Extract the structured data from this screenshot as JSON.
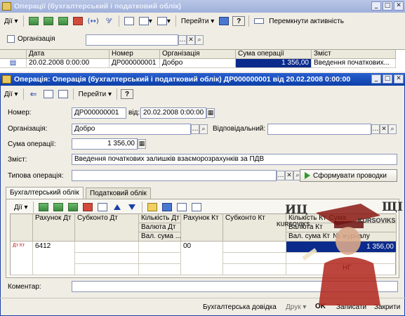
{
  "back_window": {
    "title": "Операції (бухгалтерський і податковий облік)",
    "toolbar": {
      "actions_label": "Дії",
      "goto_label": "Перейти",
      "toggle_activity_label": "Перемкнути активність"
    },
    "filter": {
      "org_label": "Організація",
      "org_value": ""
    },
    "columns": [
      "Дата",
      "Номер",
      "Організація",
      "Сума операції",
      "Зміст"
    ],
    "row": {
      "date": "20.02.2008 0:00:00",
      "number": "ДР000000001",
      "org": "Добро",
      "sum": "1 356,00",
      "content": "Введення початкових..."
    }
  },
  "form": {
    "title": "Операція: Операція (бухгалтерський і податковий облік) ДР000000001 від 20.02.2008 0:00:00",
    "toolbar": {
      "actions_label": "Дії",
      "goto_label": "Перейти"
    },
    "number_label": "Номер:",
    "number_value": "ДР000000001",
    "from_label": "від:",
    "date_value": "20.02.2008  0:00:00",
    "org_label": "Організація:",
    "org_value": "Добро",
    "responsible_label": "Відповідальний:",
    "responsible_value": "",
    "sum_label": "Сума операції:",
    "sum_value": "1 356,00",
    "content_label": "Зміст:",
    "content_value": "Введення початкових залишків взаєморозрахунків за ПДВ",
    "typical_label": "Типова операція:",
    "typical_value": "",
    "generate_label": "Сформувати проводки",
    "tabs": [
      "Бухгалтерський облік",
      "Податковий облік"
    ],
    "grid": {
      "actions_label": "Дії",
      "hdr_debit_account": "Рахунок Дт",
      "hdr_subconto_dt": "Субконто Дт",
      "hdr_qty_dt": "Кількість Дт",
      "hdr_currency_dt": "Валюта Дт",
      "hdr_cur_sum": "Вал. сума ...",
      "hdr_credit_account": "Рахунок Кт",
      "hdr_subconto_kt": "Субконто Кт",
      "hdr_qty_kt": "Кількість Кт",
      "hdr_sum": "Сума",
      "hdr_currency_kt": "Валюта Кт",
      "hdr_note": "Вал. сума Кт",
      "hdr_journal": "№ журналу",
      "row_icon": "Дт Кт",
      "row_debit": "6412",
      "row_credit": "00",
      "row_sum": "1 356,00",
      "row_extra": "НГ"
    },
    "comment_label": "Коментар:",
    "comment_value": "",
    "footer": {
      "help_label": "Бухгалтерська довідка",
      "print_label": "Друк",
      "ok_label": "OK",
      "save_label": "Записати",
      "close_label": "Закрити"
    }
  },
  "watermark": {
    "left": "ИЦ",
    "left_sub": "KURSOVIKS",
    "right": "ЩI",
    "right_sub": "KURSOVIKS"
  },
  "colors": {
    "active_title": "#0b3fa8",
    "inactive_title": "#a7b6dc",
    "selection": "#0a2a8c"
  }
}
